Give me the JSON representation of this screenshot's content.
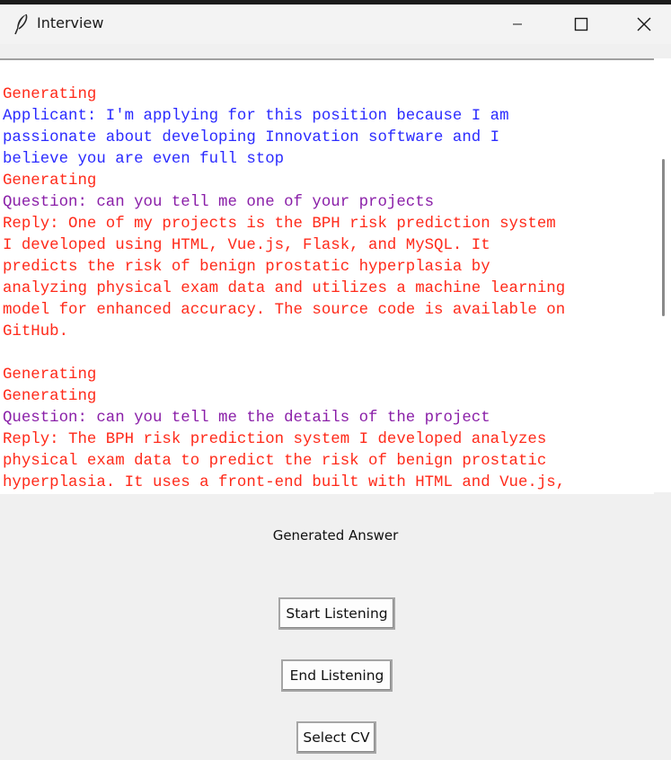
{
  "window": {
    "title": "Interview",
    "app_icon": "feather-icon",
    "controls": [
      "minimize-icon",
      "maximize-icon",
      "close-icon"
    ]
  },
  "transcript": {
    "lines": [
      {
        "text": "Generating",
        "color": "#ff2a1a"
      },
      {
        "text": "Applicant: I'm applying for this position because I am",
        "color": "#2b2bff"
      },
      {
        "text": "passionate about developing Innovation software and I",
        "color": "#2b2bff"
      },
      {
        "text": "believe you are even full stop",
        "color": "#2b2bff"
      },
      {
        "text": "Generating",
        "color": "#ff2a1a"
      },
      {
        "text": "Question: can you tell me one of your projects",
        "color": "#8a1fa8"
      },
      {
        "text": "Reply: One of my projects is the BPH risk prediction system",
        "color": "#ff2a1a"
      },
      {
        "text": "I developed using HTML, Vue.js, Flask, and MySQL. It",
        "color": "#ff2a1a"
      },
      {
        "text": "predicts the risk of benign prostatic hyperplasia by",
        "color": "#ff2a1a"
      },
      {
        "text": "analyzing physical exam data and utilizes a machine learning",
        "color": "#ff2a1a"
      },
      {
        "text": "model for enhanced accuracy. The source code is available on",
        "color": "#ff2a1a"
      },
      {
        "text": "GitHub.",
        "color": "#ff2a1a"
      },
      {
        "text": "",
        "color": "#ff2a1a"
      },
      {
        "text": "Generating",
        "color": "#ff2a1a"
      },
      {
        "text": "Generating",
        "color": "#ff2a1a"
      },
      {
        "text": "Question: can you tell me the details of the project",
        "color": "#8a1fa8"
      },
      {
        "text": "Reply: The BPH risk prediction system I developed analyzes",
        "color": "#ff2a1a"
      },
      {
        "text": "physical exam data to predict the risk of benign prostatic",
        "color": "#ff2a1a"
      },
      {
        "text": "hyperplasia. It uses a front-end built with HTML and Vue.js,",
        "color": "#ff2a1a"
      }
    ]
  },
  "status_label": "Generated Answer",
  "buttons": {
    "start": "Start Listening",
    "end": "End Listening",
    "select_cv": "Select CV"
  }
}
